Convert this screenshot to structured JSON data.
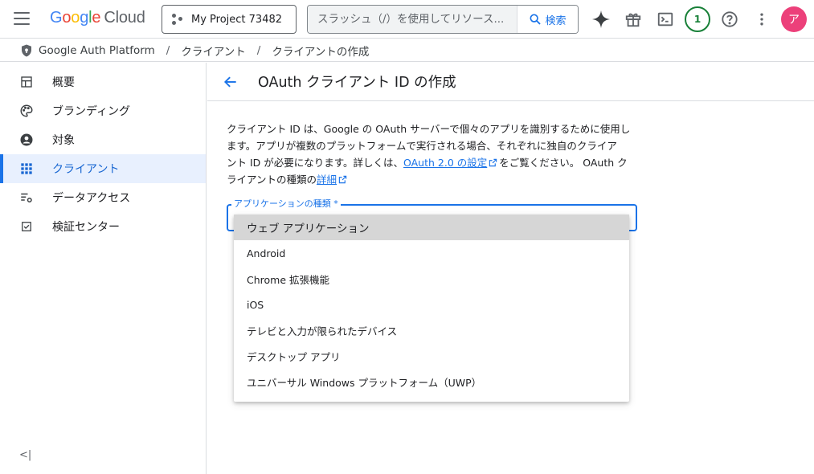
{
  "topbar": {
    "logo_google": [
      "G",
      "o",
      "o",
      "g",
      "l",
      "e"
    ],
    "logo_cloud": "Cloud",
    "project": "My Project 73482",
    "search_placeholder": "スラッシュ（/）を使用してリソース...",
    "search_button": "検索",
    "notifications_count": "1",
    "avatar_letter": "ア"
  },
  "breadcrumb": {
    "items": [
      "Google Auth Platform",
      "クライアント",
      "クライアントの作成"
    ]
  },
  "sidebar": {
    "items": [
      {
        "label": "概要",
        "icon": "dashboard-icon"
      },
      {
        "label": "ブランディング",
        "icon": "palette-icon"
      },
      {
        "label": "対象",
        "icon": "person-icon"
      },
      {
        "label": "クライアント",
        "icon": "grid-icon",
        "active": true
      },
      {
        "label": "データアクセス",
        "icon": "data-settings-icon"
      },
      {
        "label": "検証センター",
        "icon": "verify-icon"
      }
    ],
    "collapse_label": "<|"
  },
  "main": {
    "title": "OAuth クライアント ID の作成",
    "description": {
      "line1": "クライアント ID は、Google の OAuth サーバーで個々のアプリを識別するために使用し",
      "line2": "ます。アプリが複数のプラットフォームで実行される場合、それぞれに独自のクライア",
      "line3_a": "ント ID が必要になります。詳しくは、",
      "link1": "OAuth 2.0 の設定",
      "line3_b": "をご覧ください。 OAuth ク",
      "line4_a": "ライアントの種類の",
      "link2": "詳細"
    },
    "select_label": "アプリケーションの種類 *",
    "options": [
      "ウェブ アプリケーション",
      "Android",
      "Chrome 拡張機能",
      "iOS",
      "テレビと入力が限られたデバイス",
      "デスクトップ アプリ",
      "ユニバーサル Windows プラットフォーム（UWP）"
    ],
    "highlighted_option": 0
  },
  "colors": {
    "accent": "#1a73e8",
    "active_bg": "#e8f0fe",
    "avatar": "#ec407a",
    "notif": "#188038"
  }
}
